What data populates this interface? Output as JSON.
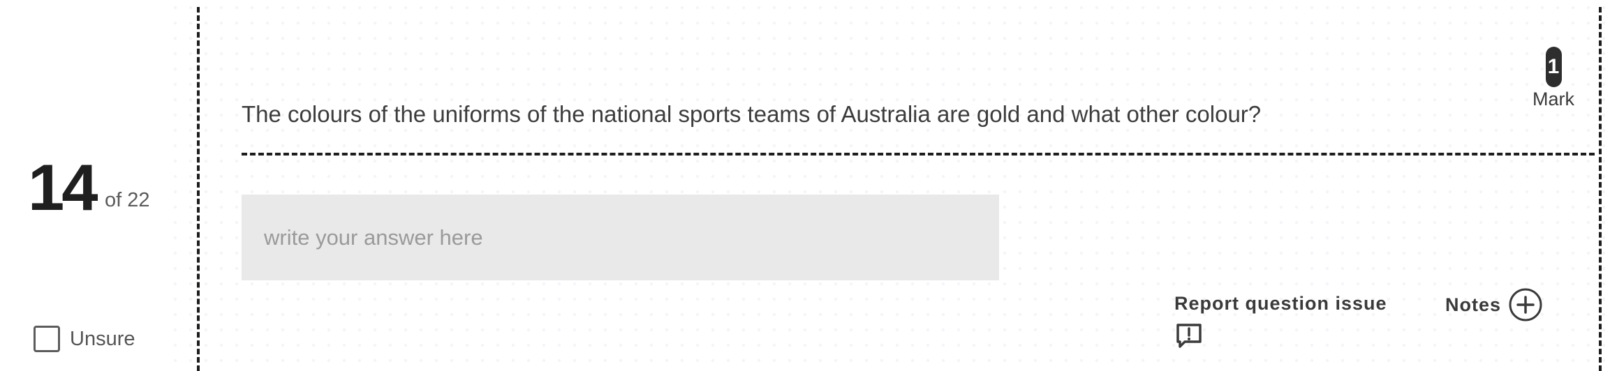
{
  "question": {
    "number": "14",
    "total_label": "of 22",
    "text": "The colours of the uniforms of the national sports teams of Australia are gold and what other colour?",
    "marks": "1",
    "marks_label": "Mark"
  },
  "answer": {
    "value": "",
    "placeholder": "write your answer here"
  },
  "unsure": {
    "label": "Unsure",
    "checked": false
  },
  "actions": {
    "report_label": "Report question issue",
    "report_icon": "report-issue-icon",
    "notes_label": "Notes",
    "notes_icon": "plus-circle-icon"
  }
}
